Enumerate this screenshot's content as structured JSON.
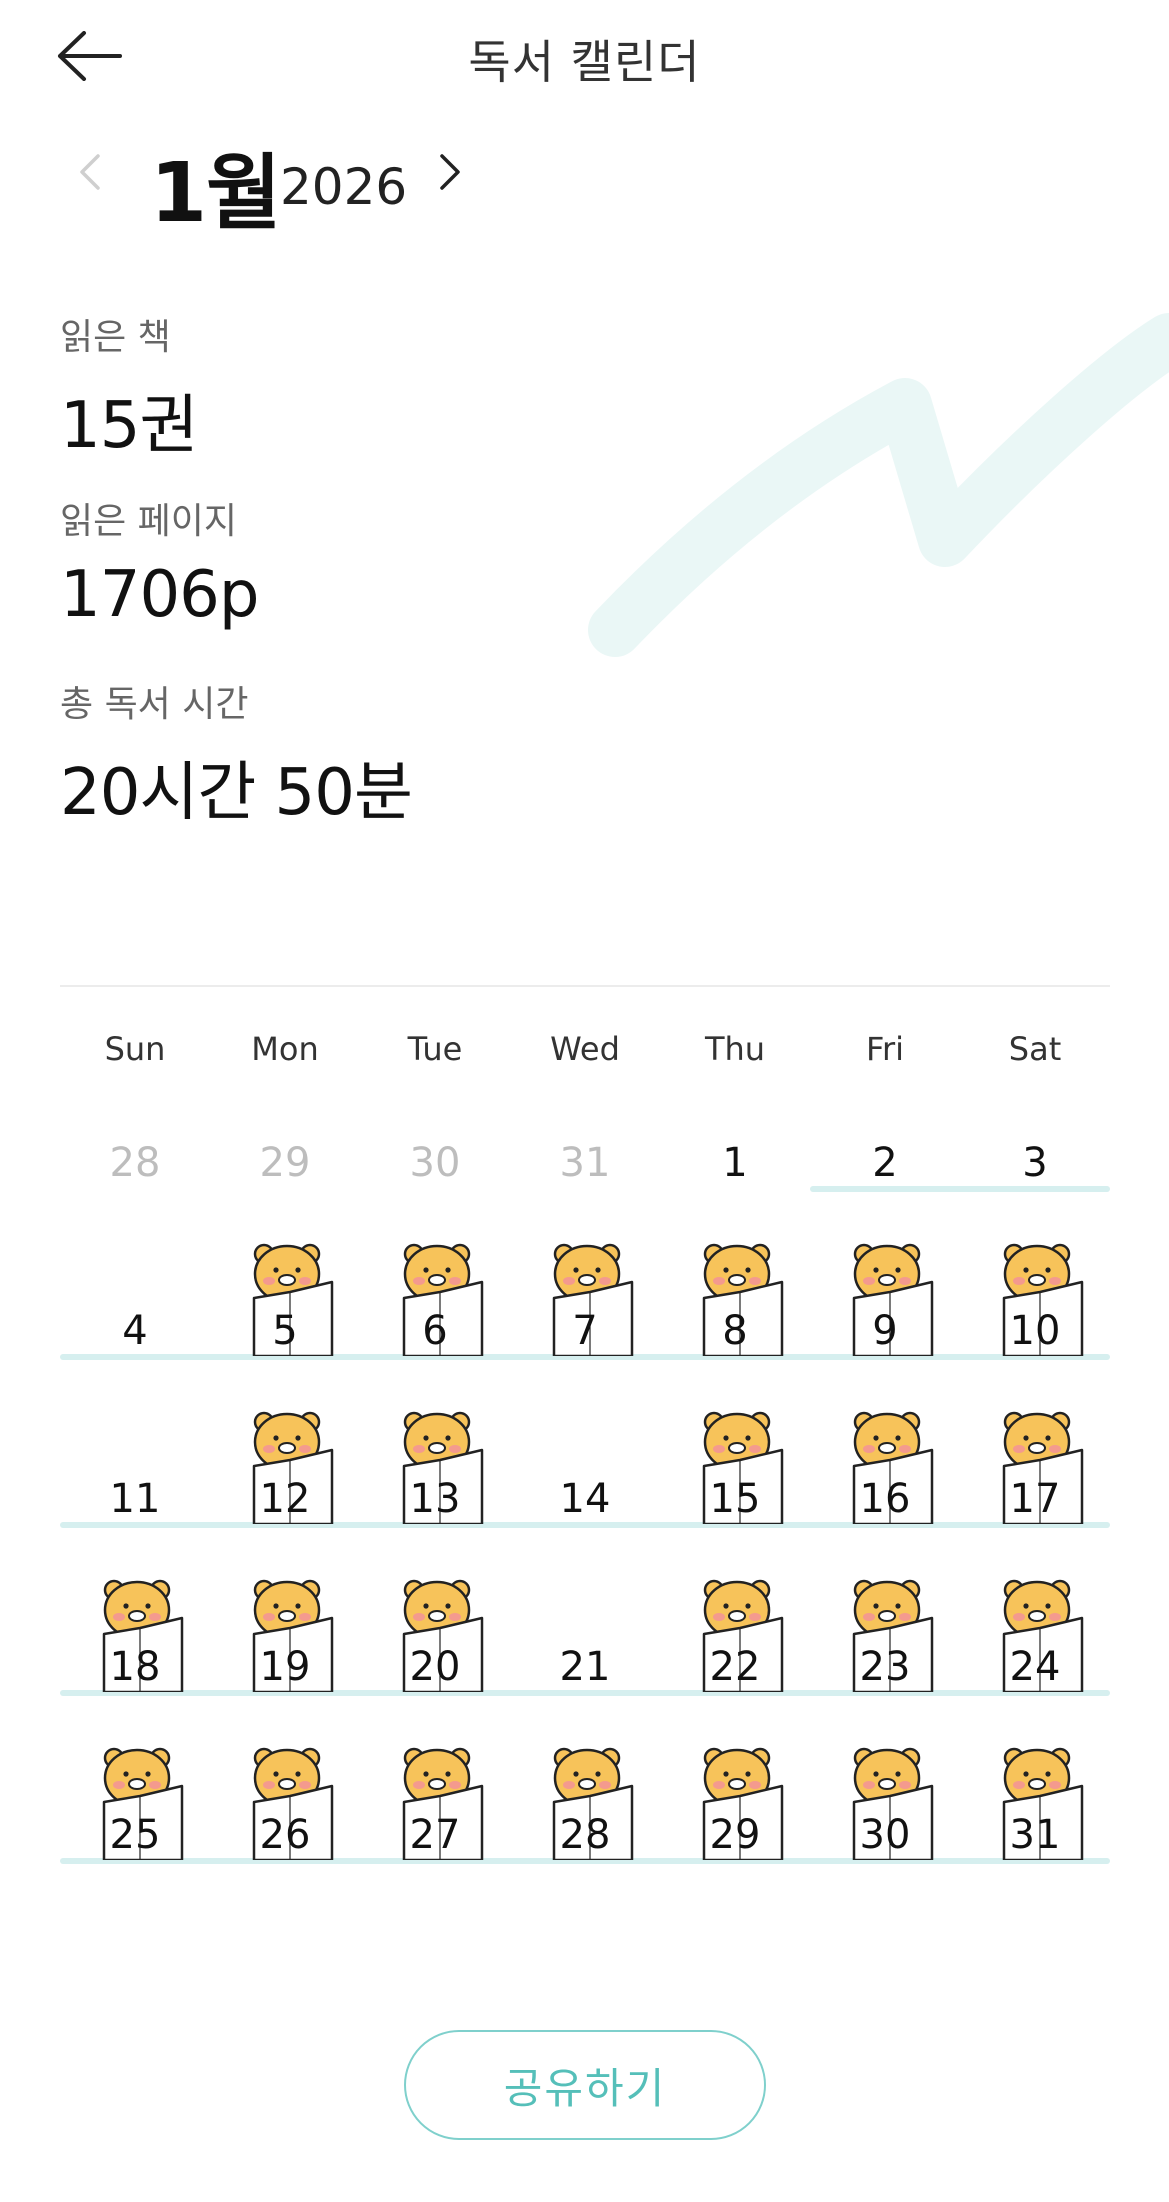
{
  "header": {
    "title": "독서 캘린더"
  },
  "month_nav": {
    "month": "1월",
    "year": "2026"
  },
  "stats": {
    "books": {
      "label": "읽은 책",
      "value": "15권"
    },
    "pages": {
      "label": "읽은 페이지",
      "value": "1706p"
    },
    "time": {
      "label": "총 독서 시간",
      "value": "20시간 50분"
    }
  },
  "calendar": {
    "weekdays": [
      "Sun",
      "Mon",
      "Tue",
      "Wed",
      "Thu",
      "Fri",
      "Sat"
    ],
    "weeks": [
      [
        {
          "day": "28",
          "other_month": true,
          "read": false
        },
        {
          "day": "29",
          "other_month": true,
          "read": false
        },
        {
          "day": "30",
          "other_month": true,
          "read": false
        },
        {
          "day": "31",
          "other_month": true,
          "read": false
        },
        {
          "day": "1",
          "other_month": false,
          "read": false
        },
        {
          "day": "2",
          "other_month": false,
          "read": false
        },
        {
          "day": "3",
          "other_month": false,
          "read": false
        }
      ],
      [
        {
          "day": "4",
          "other_month": false,
          "read": false
        },
        {
          "day": "5",
          "other_month": false,
          "read": true
        },
        {
          "day": "6",
          "other_month": false,
          "read": true
        },
        {
          "day": "7",
          "other_month": false,
          "read": true
        },
        {
          "day": "8",
          "other_month": false,
          "read": true
        },
        {
          "day": "9",
          "other_month": false,
          "read": true
        },
        {
          "day": "10",
          "other_month": false,
          "read": true
        }
      ],
      [
        {
          "day": "11",
          "other_month": false,
          "read": false
        },
        {
          "day": "12",
          "other_month": false,
          "read": true
        },
        {
          "day": "13",
          "other_month": false,
          "read": true
        },
        {
          "day": "14",
          "other_month": false,
          "read": false
        },
        {
          "day": "15",
          "other_month": false,
          "read": true
        },
        {
          "day": "16",
          "other_month": false,
          "read": true
        },
        {
          "day": "17",
          "other_month": false,
          "read": true
        }
      ],
      [
        {
          "day": "18",
          "other_month": false,
          "read": true
        },
        {
          "day": "19",
          "other_month": false,
          "read": true
        },
        {
          "day": "20",
          "other_month": false,
          "read": true
        },
        {
          "day": "21",
          "other_month": false,
          "read": false
        },
        {
          "day": "22",
          "other_month": false,
          "read": true
        },
        {
          "day": "23",
          "other_month": false,
          "read": true
        },
        {
          "day": "24",
          "other_month": false,
          "read": true
        }
      ],
      [
        {
          "day": "25",
          "other_month": false,
          "read": true
        },
        {
          "day": "26",
          "other_month": false,
          "read": true
        },
        {
          "day": "27",
          "other_month": false,
          "read": true
        },
        {
          "day": "28",
          "other_month": false,
          "read": true
        },
        {
          "day": "29",
          "other_month": false,
          "read": true
        },
        {
          "day": "30",
          "other_month": false,
          "read": true
        },
        {
          "day": "31",
          "other_month": false,
          "read": true
        }
      ]
    ]
  },
  "share": {
    "label": "공유하기"
  },
  "colors": {
    "accent": "#55bfb9",
    "underline": "#d6efef",
    "decoration": "#eaf7f6",
    "sticker_face": "#f7c35a",
    "sticker_cheek": "#f49a8e"
  }
}
